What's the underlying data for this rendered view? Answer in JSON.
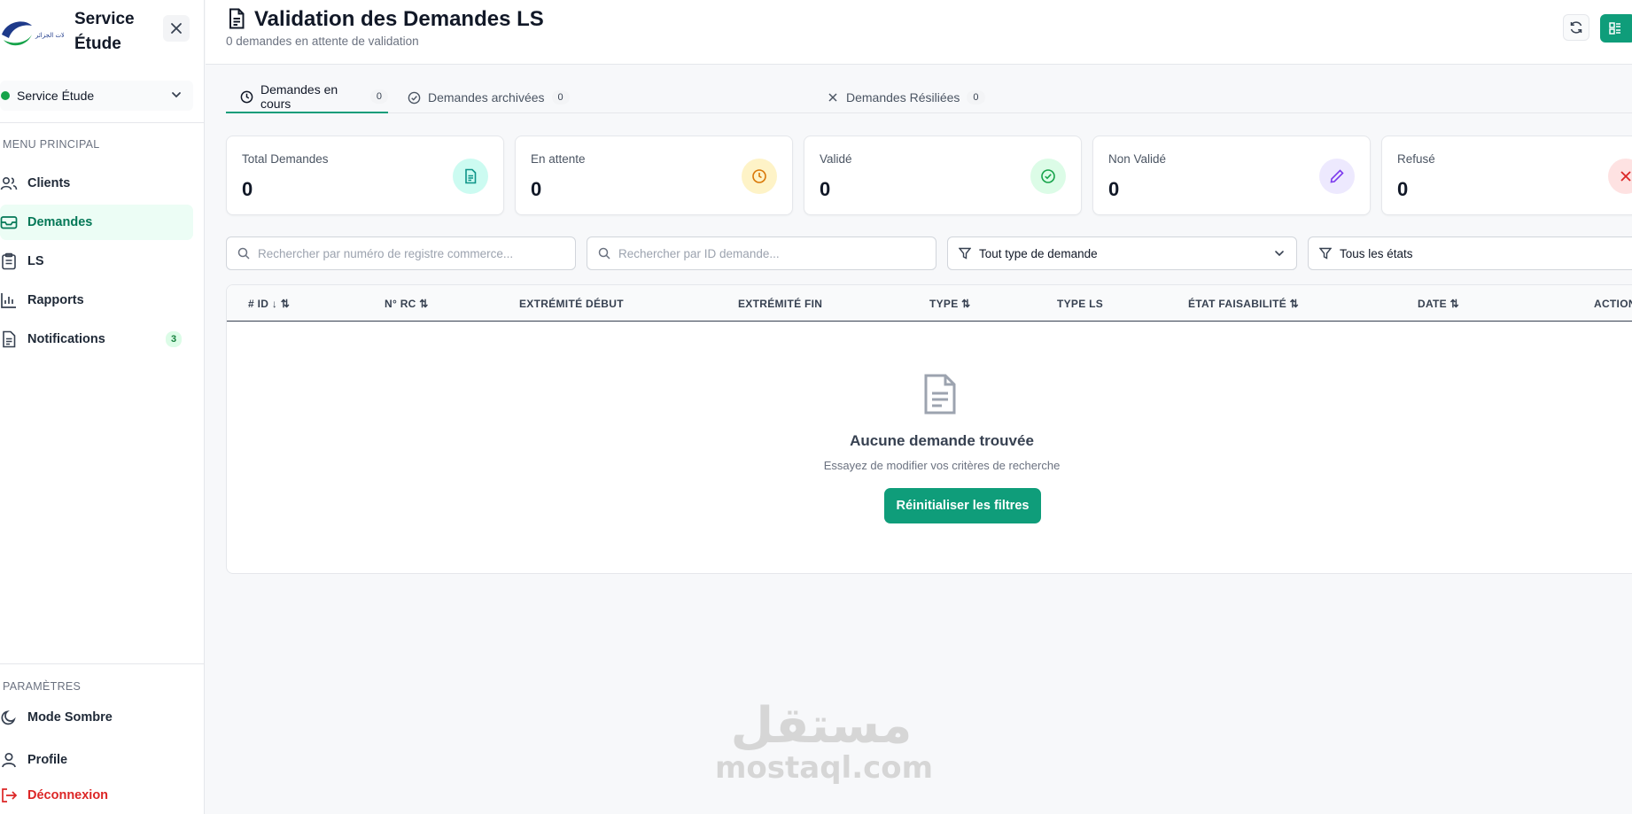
{
  "brand": {
    "title": "Service Étude",
    "logo_text": "اتصالات الجزائر"
  },
  "service_select": {
    "label": "Service Étude",
    "status_color": "#16a34a"
  },
  "menu": {
    "section_label": "MENU PRINCIPAL",
    "items": [
      {
        "label": "Clients",
        "icon": "users-icon"
      },
      {
        "label": "Demandes",
        "icon": "inbox-icon",
        "active": true
      },
      {
        "label": "LS",
        "icon": "clipboard-icon"
      },
      {
        "label": "Rapports",
        "icon": "bar-chart-icon"
      },
      {
        "label": "Notifications",
        "icon": "file-icon",
        "badge": "3"
      }
    ]
  },
  "settings": {
    "section_label": "PARAMÈTRES",
    "items": [
      {
        "label": "Mode Sombre",
        "icon": "moon-icon"
      },
      {
        "label": "Profile",
        "icon": "user-icon"
      },
      {
        "label": "Déconnexion",
        "icon": "logout-icon"
      }
    ]
  },
  "header": {
    "title": "Validation des Demandes LS",
    "subtitle": "0 demandes en attente de validation"
  },
  "tabs": [
    {
      "label": "Demandes en cours",
      "count": "0",
      "active": true
    },
    {
      "label": "Demandes archivées",
      "count": "0"
    },
    {
      "label": "Demandes Résiliées",
      "count": "0"
    }
  ],
  "stats": [
    {
      "label": "Total Demandes",
      "value": "0",
      "color": "#0d9488",
      "bg": "#ccfbf1"
    },
    {
      "label": "En attente",
      "value": "0",
      "color": "#d97706",
      "bg": "#fef3c7"
    },
    {
      "label": "Validé",
      "value": "0",
      "color": "#16a34a",
      "bg": "#dcfce7"
    },
    {
      "label": "Non Validé",
      "value": "0",
      "color": "#7c3aed",
      "bg": "#ede9fe"
    },
    {
      "label": "Refusé",
      "value": "0",
      "color": "#dc2626",
      "bg": "#fee2e2"
    }
  ],
  "filters": {
    "search_rc_placeholder": "Rechercher par numéro de registre commerce...",
    "search_id_placeholder": "Rechercher par ID demande...",
    "type_select": "Tout type de demande",
    "state_select": "Tous les états"
  },
  "table": {
    "columns": [
      "# ID ↓ ⇅",
      "N° RC ⇅",
      "EXTRÉMITÉ DÉBUT",
      "EXTRÉMITÉ FIN",
      "TYPE ⇅",
      "TYPE LS",
      "ÉTAT FAISABILITÉ ⇅",
      "DATE ⇅",
      "ACTION"
    ],
    "empty_title": "Aucune demande trouvée",
    "empty_subtitle": "Essayez de modifier vos critères de recherche",
    "reset_label": "Réinitialiser les filtres"
  },
  "watermark": {
    "arabic": "مستقل",
    "latin": "mostaql.com"
  }
}
